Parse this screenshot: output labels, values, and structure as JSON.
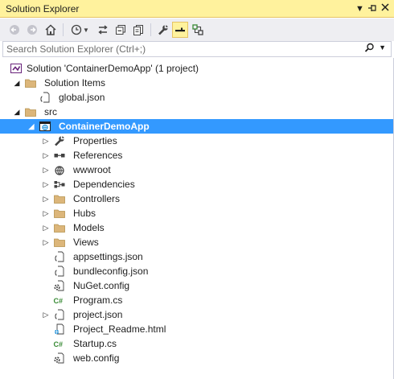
{
  "window": {
    "title": "Solution Explorer",
    "title_buttons": [
      "dropdown",
      "pin",
      "close"
    ]
  },
  "toolbar": {
    "buttons": [
      {
        "name": "back",
        "icon": "back-arrow-icon",
        "enabled": false
      },
      {
        "name": "forward",
        "icon": "forward-arrow-icon",
        "enabled": false
      },
      {
        "name": "home",
        "icon": "home-icon",
        "enabled": true
      },
      {
        "name": "pending-changes-filter",
        "icon": "clock-icon",
        "enabled": true
      },
      {
        "name": "sync-with-active-document",
        "icon": "sync-icon",
        "enabled": true
      },
      {
        "name": "collapse-all",
        "icon": "collapse-icon",
        "enabled": true
      },
      {
        "name": "show-all-files",
        "icon": "copy-icon",
        "enabled": true
      },
      {
        "name": "properties",
        "icon": "wrench-icon",
        "enabled": true
      },
      {
        "name": "preview-selected-items",
        "icon": "preview-icon",
        "enabled": true,
        "active": true
      },
      {
        "name": "class-view",
        "icon": "class-diagram-icon",
        "enabled": true
      }
    ]
  },
  "search": {
    "placeholder": "Search Solution Explorer (Ctrl+;)",
    "value": ""
  },
  "tree": [
    {
      "label": "Solution 'ContainerDemoApp' (1 project)",
      "icon": "solution-icon",
      "expander": "none"
    },
    {
      "label": "Solution Items",
      "icon": "folder-icon",
      "expander": "expanded"
    },
    {
      "label": "global.json",
      "icon": "json-file-icon",
      "expander": "none"
    },
    {
      "label": "src",
      "icon": "folder-icon",
      "expander": "expanded"
    },
    {
      "label": "ContainerDemoApp",
      "icon": "web-project-icon",
      "expander": "expanded",
      "selected": true
    },
    {
      "label": "Properties",
      "icon": "wrench-icon",
      "expander": "collapsed"
    },
    {
      "label": "References",
      "icon": "references-icon",
      "expander": "collapsed"
    },
    {
      "label": "wwwroot",
      "icon": "globe-icon",
      "expander": "collapsed"
    },
    {
      "label": "Dependencies",
      "icon": "dependencies-icon",
      "expander": "collapsed"
    },
    {
      "label": "Controllers",
      "icon": "folder-icon",
      "expander": "collapsed"
    },
    {
      "label": "Hubs",
      "icon": "folder-icon",
      "expander": "collapsed"
    },
    {
      "label": "Models",
      "icon": "folder-icon",
      "expander": "collapsed"
    },
    {
      "label": "Views",
      "icon": "folder-icon",
      "expander": "collapsed"
    },
    {
      "label": "appsettings.json",
      "icon": "json-file-icon",
      "expander": "none"
    },
    {
      "label": "bundleconfig.json",
      "icon": "json-file-icon",
      "expander": "none"
    },
    {
      "label": "NuGet.config",
      "icon": "config-file-icon",
      "expander": "none"
    },
    {
      "label": "Program.cs",
      "icon": "csharp-file-icon",
      "expander": "none"
    },
    {
      "label": "project.json",
      "icon": "json-file-icon",
      "expander": "collapsed"
    },
    {
      "label": "Project_Readme.html",
      "icon": "html-file-icon",
      "expander": "none"
    },
    {
      "label": "Startup.cs",
      "icon": "csharp-file-icon",
      "expander": "none"
    },
    {
      "label": "web.config",
      "icon": "config-file-icon",
      "expander": "none"
    }
  ],
  "colors": {
    "title_bar": "#fff29d",
    "toolbar": "#eeeef2",
    "selection": "#3399ff",
    "folder": "#dcb67a",
    "csharp": "#388a34",
    "solution": "#68217a"
  }
}
